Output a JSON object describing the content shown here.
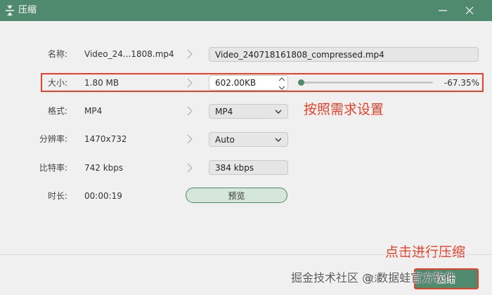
{
  "window": {
    "title": "压缩"
  },
  "rows": {
    "name": {
      "label": "名称:",
      "original": "Video_24...1808.mp4",
      "output": "Video_240718161808_compressed.mp4"
    },
    "size": {
      "label": "大小:",
      "original": "1.80 MB",
      "output": "602.00KB",
      "slider_fraction": 0.0,
      "percent": "-67.35%"
    },
    "format": {
      "label": "格式:",
      "original": "MP4",
      "selected": "MP4"
    },
    "resolution": {
      "label": "分辨率:",
      "original": "1470x732",
      "selected": "Auto"
    },
    "bitrate": {
      "label": "比特率:",
      "original": "742 kbps",
      "output": "384 kbps"
    },
    "duration": {
      "label": "时长:",
      "original": "00:00:19"
    }
  },
  "preview_label": "预览",
  "annotations": {
    "set_as_needed": "按照需求设置",
    "click_compress": "点击进行压缩"
  },
  "footer": {
    "cancel_label": "取消",
    "compress_label": "压缩"
  },
  "watermark": "掘金技术社区 @ 数据蛙官方软件",
  "colors": {
    "accent": "#4f8a6f",
    "highlight": "#e8412a"
  },
  "icons": {
    "title": "compress-icon",
    "minimize": "minimize-icon",
    "close": "close-icon",
    "arrow": "chevron-right-icon"
  }
}
